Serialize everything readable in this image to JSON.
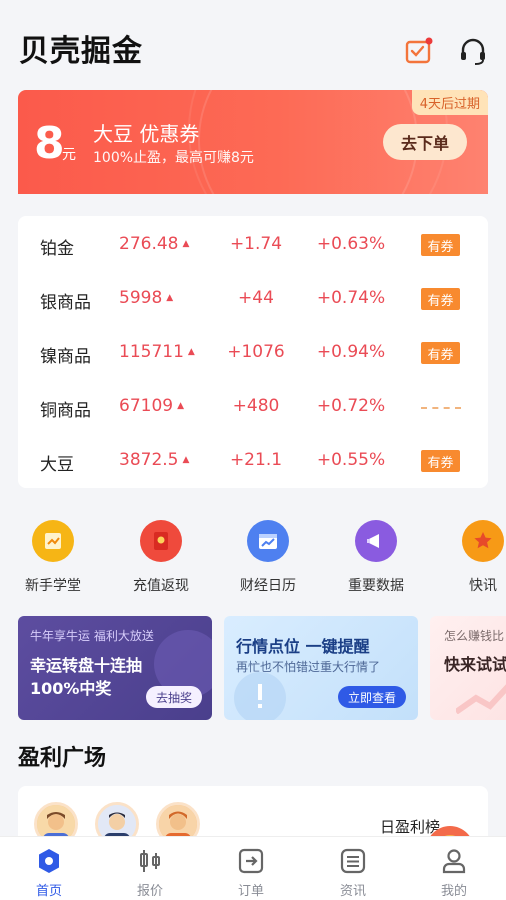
{
  "header": {
    "title": "贝壳掘金"
  },
  "coupon": {
    "amount": "8",
    "unit": "元",
    "title": "大豆 优惠券",
    "desc": "100%止盈，最高可赚8元",
    "expire": "4天后过期",
    "button": "去下单"
  },
  "quotes": [
    {
      "name": "铂金",
      "price": "276.48",
      "change": "+1.74",
      "pct": "+0.63%",
      "badge": "有券"
    },
    {
      "name": "银商品",
      "price": "5998",
      "change": "+44",
      "pct": "+0.74%",
      "badge": "有券"
    },
    {
      "name": "镍商品",
      "price": "115711",
      "change": "+1076",
      "pct": "+0.94%",
      "badge": "有券"
    },
    {
      "name": "铜商品",
      "price": "67109",
      "change": "+480",
      "pct": "+0.72%",
      "badge": ""
    },
    {
      "name": "大豆",
      "price": "3872.5",
      "change": "+21.1",
      "pct": "+0.55%",
      "badge": "有券"
    }
  ],
  "shortcuts": [
    {
      "label": "新手学堂",
      "icon": "book-icon",
      "color": "#f6b515"
    },
    {
      "label": "充值返现",
      "icon": "red-envelope-icon",
      "color": "#ef4a3c"
    },
    {
      "label": "财经日历",
      "icon": "calendar-chart-icon",
      "color": "#4e80f0"
    },
    {
      "label": "重要数据",
      "icon": "megaphone-icon",
      "color": "#8a5be0"
    },
    {
      "label": "快讯",
      "icon": "star-icon",
      "color": "#f79a16"
    }
  ],
  "promos": {
    "p1": {
      "small": "牛年享牛运 福利大放送",
      "line1": "幸运转盘十连抽",
      "line2": "100%中奖",
      "button": "去抽奖"
    },
    "p2": {
      "title": "行情点位  一键提醒",
      "desc": "再忙也不怕错过重大行情了",
      "button": "立即查看"
    },
    "p3": {
      "small": "怎么赚钱比",
      "big": "快来试试"
    }
  },
  "profit": {
    "title": "盈利广场",
    "rank_label": "日盈利榜"
  },
  "tabs": [
    {
      "label": "首页",
      "icon": "home-icon",
      "active": true
    },
    {
      "label": "报价",
      "icon": "candlestick-icon",
      "active": false
    },
    {
      "label": "订单",
      "icon": "order-icon",
      "active": false
    },
    {
      "label": "资讯",
      "icon": "news-icon",
      "active": false
    },
    {
      "label": "我的",
      "icon": "profile-icon",
      "active": false
    }
  ],
  "colors": {
    "accent": "#2f5ae6",
    "up": "#ea4b55",
    "badge": "#f88a2f",
    "banner": "#fb5a4b"
  }
}
